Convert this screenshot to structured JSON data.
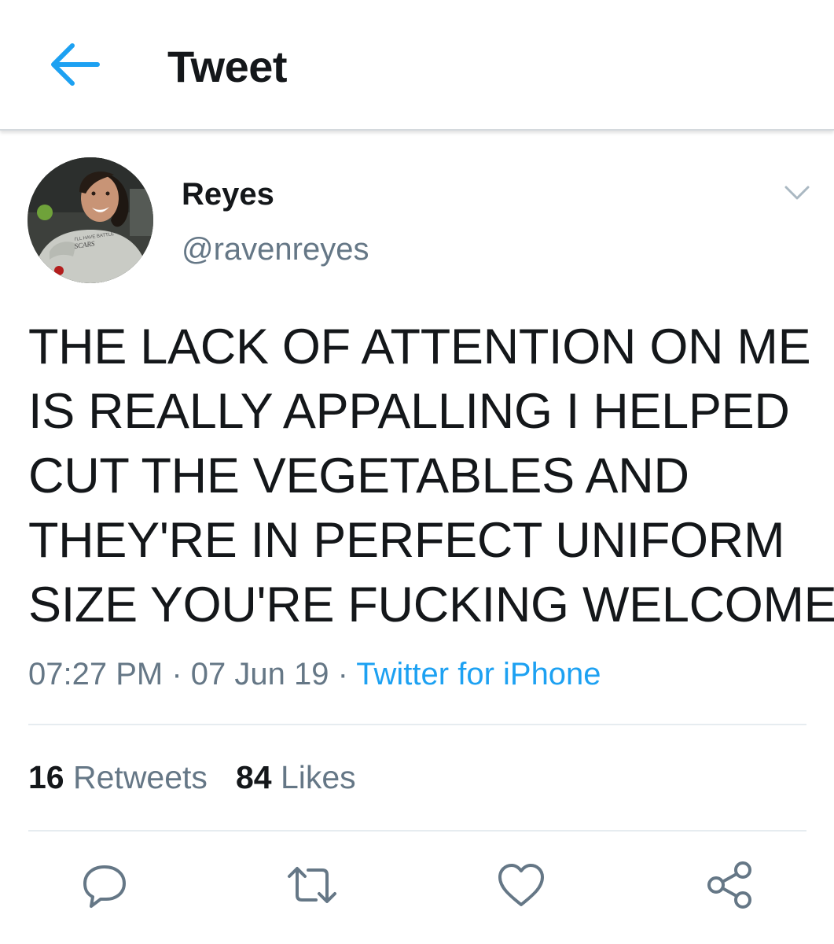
{
  "header": {
    "title": "Tweet",
    "back_icon": "arrow-left-icon"
  },
  "author": {
    "name": "Reyes",
    "handle": "@ravenreyes",
    "avatar_shirt_text_1": "I'LL HAVE BATTLE",
    "avatar_shirt_text_2": "SCARS"
  },
  "tweet": {
    "lines": [
      "THE LACK OF ATTENTION ON ME",
      "IS REALLY APPALLING I HELPED",
      "CUT THE VEGETABLES AND",
      "THEY'RE IN PERFECT UNIFORM",
      "SIZE YOU'RE FUCKING WELCOME"
    ],
    "time": "07:27 PM",
    "separator": " · ",
    "date": "07 Jun 19",
    "source": "Twitter for iPhone"
  },
  "stats": {
    "retweets_count": "16",
    "retweets_label": "Retweets",
    "likes_count": "84",
    "likes_label": "Likes"
  },
  "actions": [
    "reply-icon",
    "retweet-icon",
    "like-icon",
    "share-icon"
  ],
  "colors": {
    "accent": "#1da1f2",
    "text": "#14171a",
    "secondary": "#657786",
    "divider": "#e6ecf0"
  }
}
